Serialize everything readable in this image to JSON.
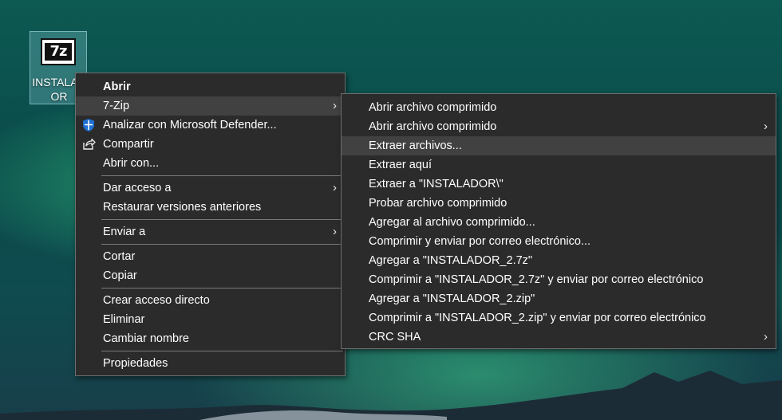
{
  "desktop_icon": {
    "label": "INSTALADOR",
    "glyph_text": "7z"
  },
  "main_menu": {
    "groups": [
      [
        {
          "label": "Abrir",
          "bold": true
        },
        {
          "label": "7-Zip",
          "submenu": true,
          "highlighted": true
        },
        {
          "label": "Analizar con Microsoft Defender...",
          "icon": "defender-shield-icon"
        },
        {
          "label": "Compartir",
          "icon": "share-icon"
        },
        {
          "label": "Abrir con..."
        }
      ],
      [
        {
          "label": "Dar acceso a",
          "submenu": true
        },
        {
          "label": "Restaurar versiones anteriores"
        }
      ],
      [
        {
          "label": "Enviar a",
          "submenu": true
        }
      ],
      [
        {
          "label": "Cortar"
        },
        {
          "label": "Copiar"
        }
      ],
      [
        {
          "label": "Crear acceso directo"
        },
        {
          "label": "Eliminar"
        },
        {
          "label": "Cambiar nombre"
        }
      ],
      [
        {
          "label": "Propiedades"
        }
      ]
    ]
  },
  "submenu_7zip": {
    "items": [
      {
        "label": "Abrir archivo comprimido"
      },
      {
        "label": "Abrir archivo comprimido",
        "submenu": true
      },
      {
        "label": "Extraer archivos...",
        "highlighted": true
      },
      {
        "label": "Extraer aquí"
      },
      {
        "label": "Extraer a \"INSTALADOR\\\""
      },
      {
        "label": "Probar archivo comprimido"
      },
      {
        "label": "Agregar al archivo comprimido..."
      },
      {
        "label": "Comprimir y enviar por correo electrónico..."
      },
      {
        "label": "Agregar a \"INSTALADOR_2.7z\""
      },
      {
        "label": "Comprimir a \"INSTALADOR_2.7z\" y enviar por correo electrónico"
      },
      {
        "label": "Agregar a \"INSTALADOR_2.zip\""
      },
      {
        "label": "Comprimir a \"INSTALADOR_2.zip\" y enviar por correo electrónico"
      },
      {
        "label": "CRC SHA",
        "submenu": true
      }
    ]
  },
  "colors": {
    "menu_bg": "#2b2b2b",
    "menu_border": "#6e6e6e",
    "highlight": "#414141",
    "defender_blue": "#1f6fd1"
  }
}
